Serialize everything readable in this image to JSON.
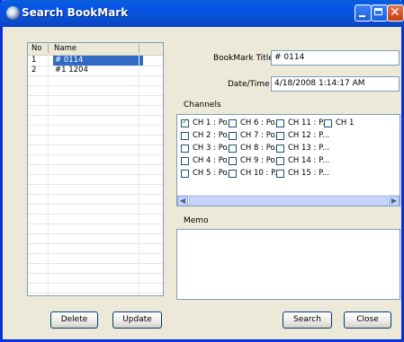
{
  "window": {
    "title": "Search BookMark"
  },
  "bookmark_list": {
    "columns": [
      "No",
      "Name"
    ],
    "rows": [
      {
        "no": "1",
        "name": "# 0114",
        "selected": true
      },
      {
        "no": "2",
        "name": "#1 1204",
        "selected": false
      }
    ]
  },
  "buttons": {
    "delete": "Delete",
    "update": "Update",
    "search": "Search",
    "close": "Close"
  },
  "fields": {
    "title_label": "BookMark Title",
    "title_value": "# 0114",
    "datetime_label": "Date/Time",
    "datetime_value": "4/18/2008 1:14:17 AM"
  },
  "channels": {
    "label": "Channels",
    "items": [
      {
        "label": "CH 1 : Po...",
        "checked": true
      },
      {
        "label": "CH 2 : Po...",
        "checked": false
      },
      {
        "label": "CH 3 : Po...",
        "checked": false
      },
      {
        "label": "CH 4 : Po...",
        "checked": false
      },
      {
        "label": "CH 5 : Po...",
        "checked": false
      },
      {
        "label": "CH 6 : Po...",
        "checked": false
      },
      {
        "label": "CH 7 : Po...",
        "checked": false
      },
      {
        "label": "CH 8 : Po...",
        "checked": false
      },
      {
        "label": "CH 9 : Po...",
        "checked": false
      },
      {
        "label": "CH 10 : P...",
        "checked": false
      },
      {
        "label": "CH 11 : P...",
        "checked": false
      },
      {
        "label": "CH 12 : P...",
        "checked": false
      },
      {
        "label": "CH 13 : P...",
        "checked": false
      },
      {
        "label": "CH 14 : P...",
        "checked": false
      },
      {
        "label": "CH 15 : P...",
        "checked": false
      },
      {
        "label": "CH 1",
        "checked": false
      }
    ]
  },
  "memo": {
    "label": "Memo",
    "value": ""
  }
}
